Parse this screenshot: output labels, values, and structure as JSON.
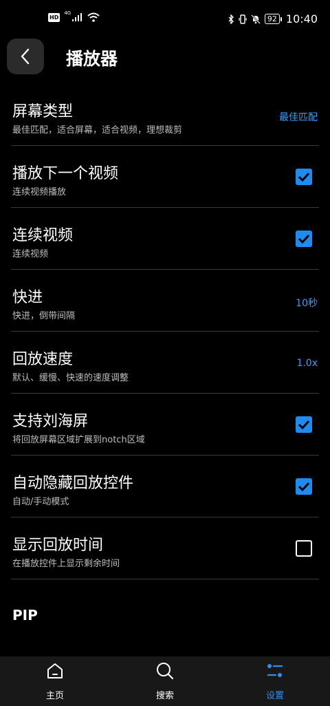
{
  "status_bar": {
    "hd_badge": "HD",
    "network": "4G",
    "battery": "92",
    "time": "10:40",
    "icons": [
      "hd-icon",
      "signal-icon",
      "wifi-icon",
      "bluetooth-icon",
      "vibrate-icon",
      "mute-bell-icon",
      "battery-icon"
    ]
  },
  "header": {
    "title": "播放器",
    "back_icon": "chevron-left-icon"
  },
  "settings": [
    {
      "title": "屏幕类型",
      "subtitle": "最佳匹配，适合屏幕，适合视频，理想裁剪",
      "value": "最佳匹配"
    },
    {
      "title": "播放下一个视频",
      "subtitle": "连续视频播放",
      "checked": true
    },
    {
      "title": "连续视频",
      "subtitle": "连续视频",
      "checked": true
    },
    {
      "title": "快进",
      "subtitle": "快进，倒带间隔",
      "value": "10秒"
    },
    {
      "title": "回放速度",
      "subtitle": "默认、缓慢、快速的速度调整",
      "value": "1.0x"
    },
    {
      "title": "支持刘海屏",
      "subtitle": "将回放屏幕区域扩展到notch区域",
      "checked": true
    },
    {
      "title": "自动隐藏回放控件",
      "subtitle": "自动/手动模式",
      "checked": true
    },
    {
      "title": "显示回放时间",
      "subtitle": "在播放控件上显示剩余时间",
      "checked": false
    }
  ],
  "section_header": "PIP",
  "bottom_nav": [
    {
      "label": "主页",
      "icon": "home-icon",
      "active": false
    },
    {
      "label": "搜索",
      "icon": "search-icon",
      "active": false
    },
    {
      "label": "设置",
      "icon": "settings-icon",
      "active": true
    }
  ],
  "colors": {
    "accent": "#1e8bf0",
    "value_text": "#3d9df5",
    "background": "#000000",
    "nav_bg": "#181818"
  }
}
